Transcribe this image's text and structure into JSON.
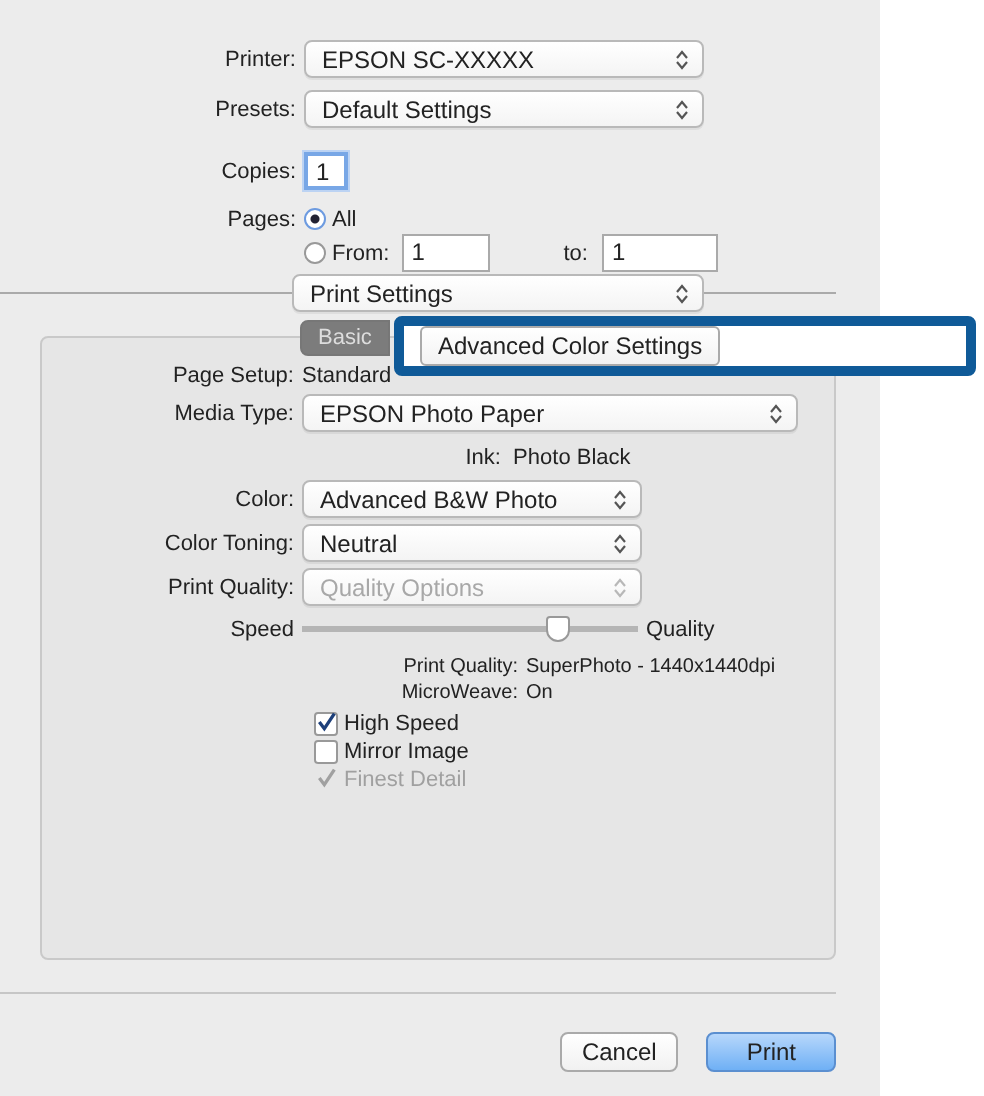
{
  "printer": {
    "label": "Printer:",
    "value": "EPSON SC-XXXXX"
  },
  "presets": {
    "label": "Presets:",
    "value": "Default Settings"
  },
  "copies": {
    "label": "Copies:",
    "value": "1"
  },
  "pages": {
    "label": "Pages:",
    "options": [
      {
        "label": "All",
        "selected": true
      },
      {
        "label": "From:",
        "selected": false
      }
    ],
    "from": "1",
    "to_label": "to:",
    "to": "1"
  },
  "section_menu": {
    "value": "Print Settings"
  },
  "tabs": [
    {
      "label": "Basic",
      "selected": true
    },
    {
      "label": "Advanced Color Settings",
      "selected": false
    }
  ],
  "page_setup": {
    "label": "Page Setup:",
    "value": "Standard"
  },
  "media_type": {
    "label": "Media Type:",
    "value": "EPSON Photo Paper"
  },
  "ink": {
    "label": "Ink:",
    "value": "Photo Black"
  },
  "popups": [
    {
      "label": "Color:",
      "value": "Advanced B&W Photo",
      "disabled": false
    },
    {
      "label": "Color Toning:",
      "value": "Neutral",
      "disabled": false
    },
    {
      "label": "Print Quality:",
      "value": "Quality Options",
      "disabled": true
    }
  ],
  "slider": {
    "start_label": "Speed",
    "end_label": "Quality",
    "level": 0.76
  },
  "info": [
    {
      "label": "Print Quality:",
      "value": "SuperPhoto - 1440x1440dpi"
    },
    {
      "label": "MicroWeave:",
      "value": "On"
    }
  ],
  "checkboxes": [
    {
      "label": "High Speed",
      "checked": true,
      "disabled": false
    },
    {
      "label": "Mirror Image",
      "checked": false,
      "disabled": false
    },
    {
      "label": "Finest Detail",
      "checked": true,
      "disabled": true
    }
  ],
  "buttons": [
    {
      "label": "Cancel",
      "default": false
    },
    {
      "label": "Print",
      "default": true
    }
  ]
}
